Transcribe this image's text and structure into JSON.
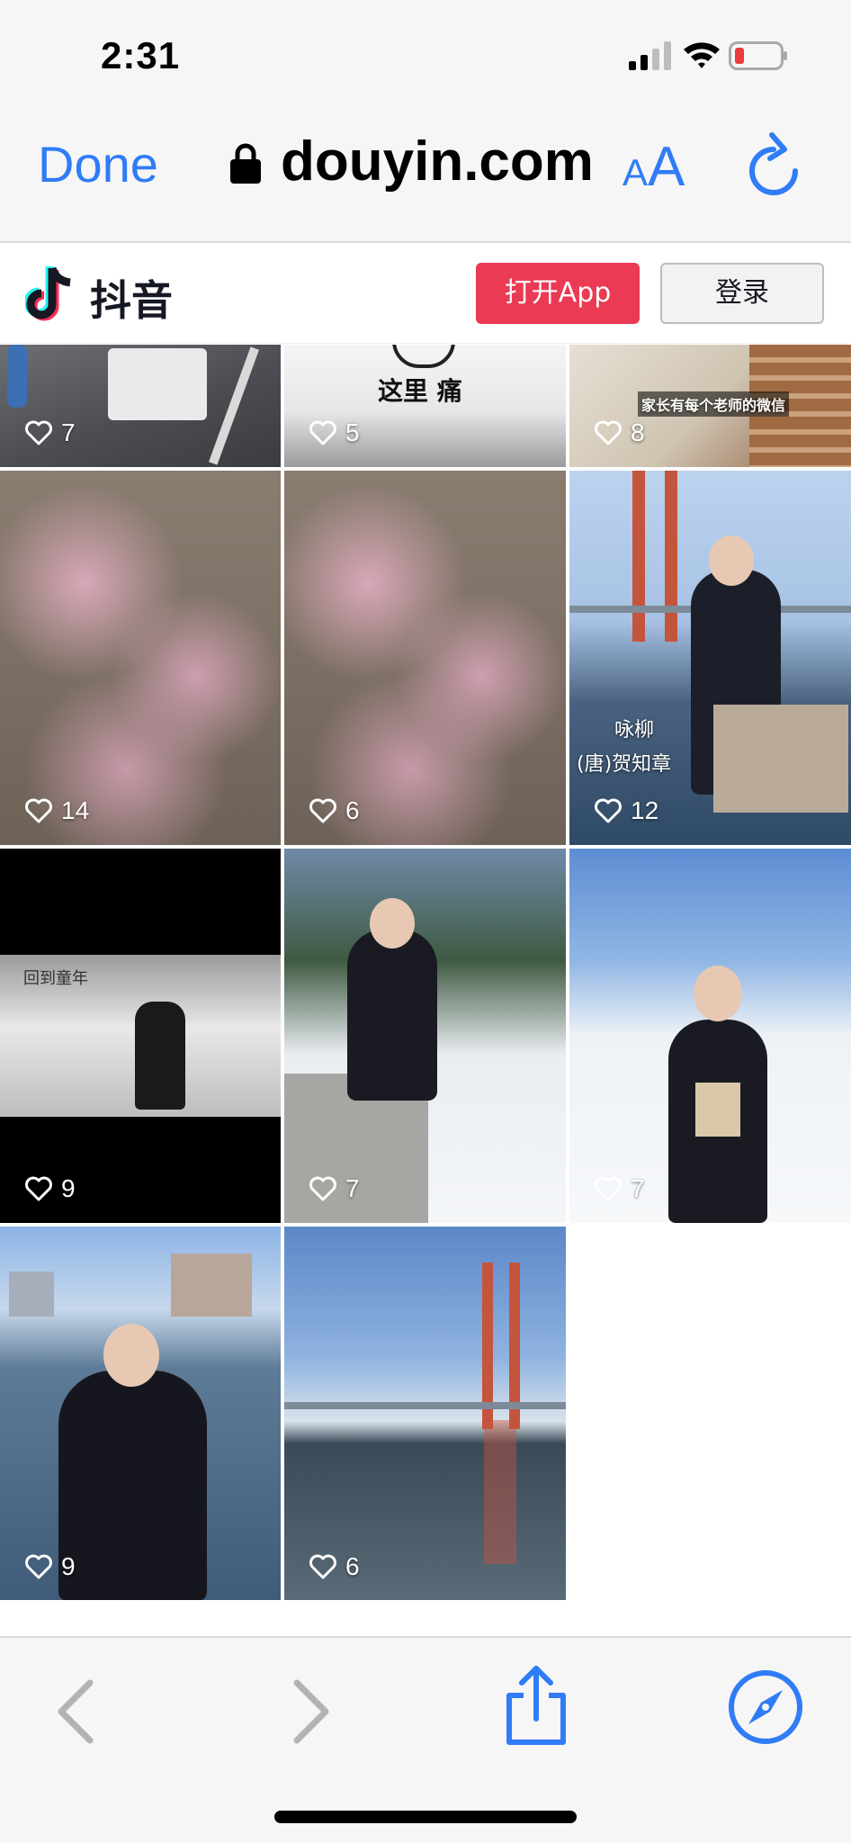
{
  "status_bar": {
    "time": "2:31"
  },
  "url_bar": {
    "done_label": "Done",
    "domain": "douyin.com",
    "aa_small": "A",
    "aa_big": "A"
  },
  "douyin_header": {
    "app_name": "抖音",
    "open_app_label": "打开App",
    "login_label": "登录"
  },
  "videos": [
    {
      "likes": "7",
      "caption": ""
    },
    {
      "likes": "5",
      "caption": "这里 痛"
    },
    {
      "likes": "8",
      "caption": "家长有每个老师的微信"
    },
    {
      "likes": "14",
      "caption": ""
    },
    {
      "likes": "6",
      "caption": ""
    },
    {
      "likes": "12",
      "caption": "咏柳",
      "caption2": "(唐)贺知章"
    },
    {
      "likes": "9",
      "caption": "回到童年"
    },
    {
      "likes": "7",
      "caption": ""
    },
    {
      "likes": "7",
      "caption": ""
    },
    {
      "likes": "9",
      "caption": ""
    },
    {
      "likes": "6",
      "caption": ""
    }
  ],
  "colors": {
    "accent": "#2f7cf6",
    "douyin_red": "#ea3a54"
  }
}
